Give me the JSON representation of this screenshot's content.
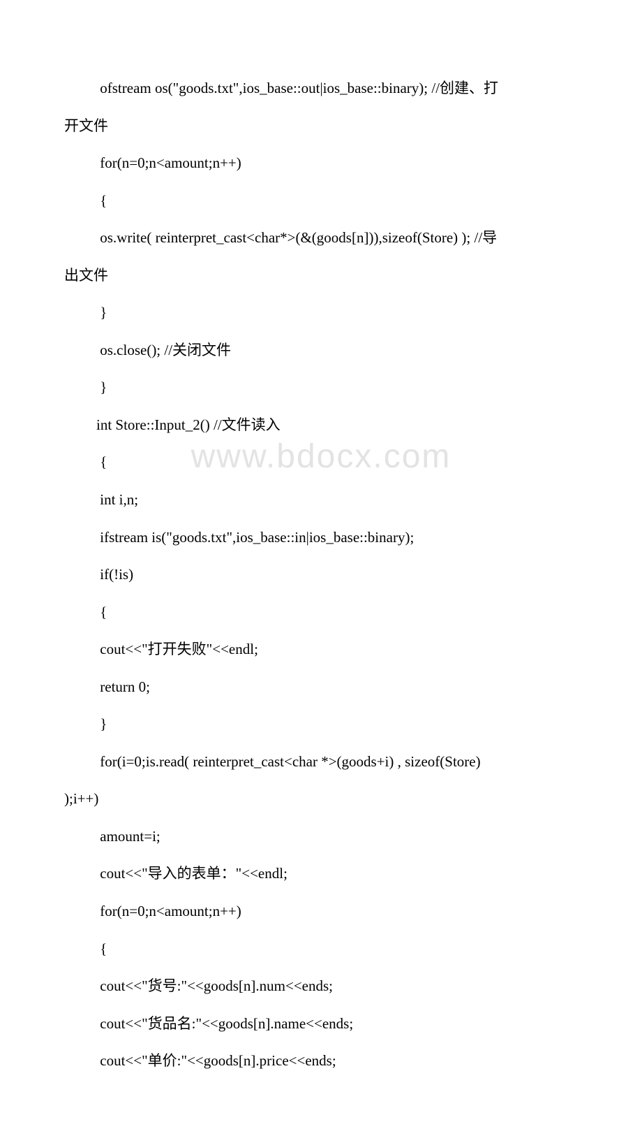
{
  "watermark": "www.bdocx.com",
  "lines": [
    {
      "cls": "indent-1",
      "text": " ofstream os(\"goods.txt\",ios_base::out|ios_base::binary); //创建、打"
    },
    {
      "cls": "wrap-0",
      "text": "开文件"
    },
    {
      "cls": "indent-1",
      "text": " for(n=0;n<amount;n++)"
    },
    {
      "cls": "indent-1",
      "text": " {"
    },
    {
      "cls": "indent-1",
      "text": " os.write( reinterpret_cast<char*>(&(goods[n])),sizeof(Store) ); //导"
    },
    {
      "cls": "wrap-0",
      "text": "出文件"
    },
    {
      "cls": "indent-1",
      "text": " }"
    },
    {
      "cls": "indent-1",
      "text": " os.close(); //关闭文件"
    },
    {
      "cls": "indent-1",
      "text": " }"
    },
    {
      "cls": "indent-1",
      "text": "int Store::Input_2() //文件读入"
    },
    {
      "cls": "indent-1",
      "text": " {"
    },
    {
      "cls": "indent-1",
      "text": " int i,n;"
    },
    {
      "cls": "indent-1",
      "text": " ifstream is(\"goods.txt\",ios_base::in|ios_base::binary);"
    },
    {
      "cls": "indent-1",
      "text": " if(!is)"
    },
    {
      "cls": "indent-1",
      "text": " {"
    },
    {
      "cls": "indent-1",
      "text": " cout<<\"打开失败\"<<endl;"
    },
    {
      "cls": "indent-1",
      "text": " return 0;"
    },
    {
      "cls": "indent-1",
      "text": " }"
    },
    {
      "cls": "indent-1",
      "text": " for(i=0;is.read( reinterpret_cast<char *>(goods+i) , sizeof(Store) "
    },
    {
      "cls": "wrap-0",
      "text": ");i++)"
    },
    {
      "cls": "indent-1",
      "text": " amount=i;"
    },
    {
      "cls": "indent-1",
      "text": " cout<<\"导入的表单：\"<<endl;"
    },
    {
      "cls": "indent-1",
      "text": " for(n=0;n<amount;n++)"
    },
    {
      "cls": "indent-1",
      "text": " {"
    },
    {
      "cls": "indent-1",
      "text": " cout<<\"货号:\"<<goods[n].num<<ends;"
    },
    {
      "cls": "indent-1",
      "text": " cout<<\"货品名:\"<<goods[n].name<<ends;"
    },
    {
      "cls": "indent-1",
      "text": " cout<<\"单价:\"<<goods[n].price<<ends;"
    }
  ]
}
